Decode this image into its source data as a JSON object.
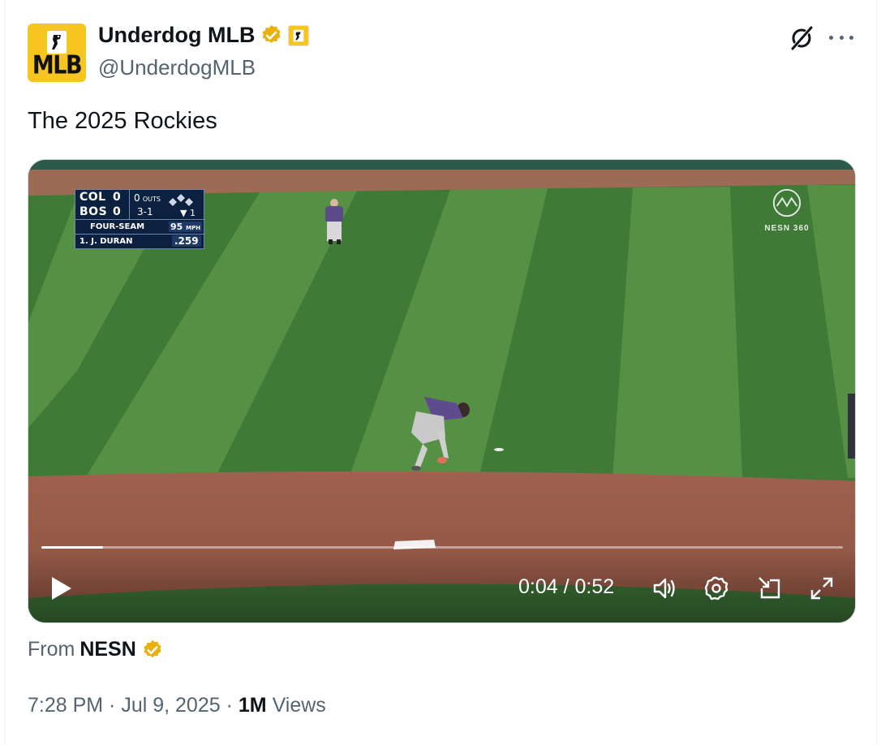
{
  "author": {
    "display_name": "Underdog MLB",
    "handle": "@UnderdogMLB",
    "avatar_text": "MLB",
    "verified_badge_color": "#f4b400"
  },
  "tweet": {
    "text": "The 2025 Rockies"
  },
  "video": {
    "scorebug": {
      "team_away": "COL",
      "score_away": "0",
      "team_home": "BOS",
      "score_home": "0",
      "outs": "0",
      "outs_label": "OUTS",
      "count": "3-1",
      "inning": "1",
      "pitch_type": "FOUR-SEAM",
      "pitch_speed": "95",
      "pitch_unit": "MPH",
      "batter": "1.  J. DURAN",
      "batter_avg": ".259"
    },
    "network_logo": "NESN 360",
    "progress": 0.077,
    "current_time": "0:04",
    "separator": " / ",
    "duration": "0:52"
  },
  "source": {
    "prefix": "From",
    "name": "NESN"
  },
  "meta": {
    "time": "7:28 PM",
    "dot": " · ",
    "date": "Jul 9, 2025",
    "views_count": "1M",
    "views_label": "Views"
  },
  "icons": [
    "grok-icon",
    "more-icon",
    "play-icon",
    "volume-icon",
    "settings-icon",
    "pip-icon",
    "fullscreen-icon",
    "verified-badge-icon"
  ],
  "colors": {
    "accent_yellow": "#f7c51f",
    "text_primary": "#0f1419",
    "text_secondary": "#536471"
  }
}
